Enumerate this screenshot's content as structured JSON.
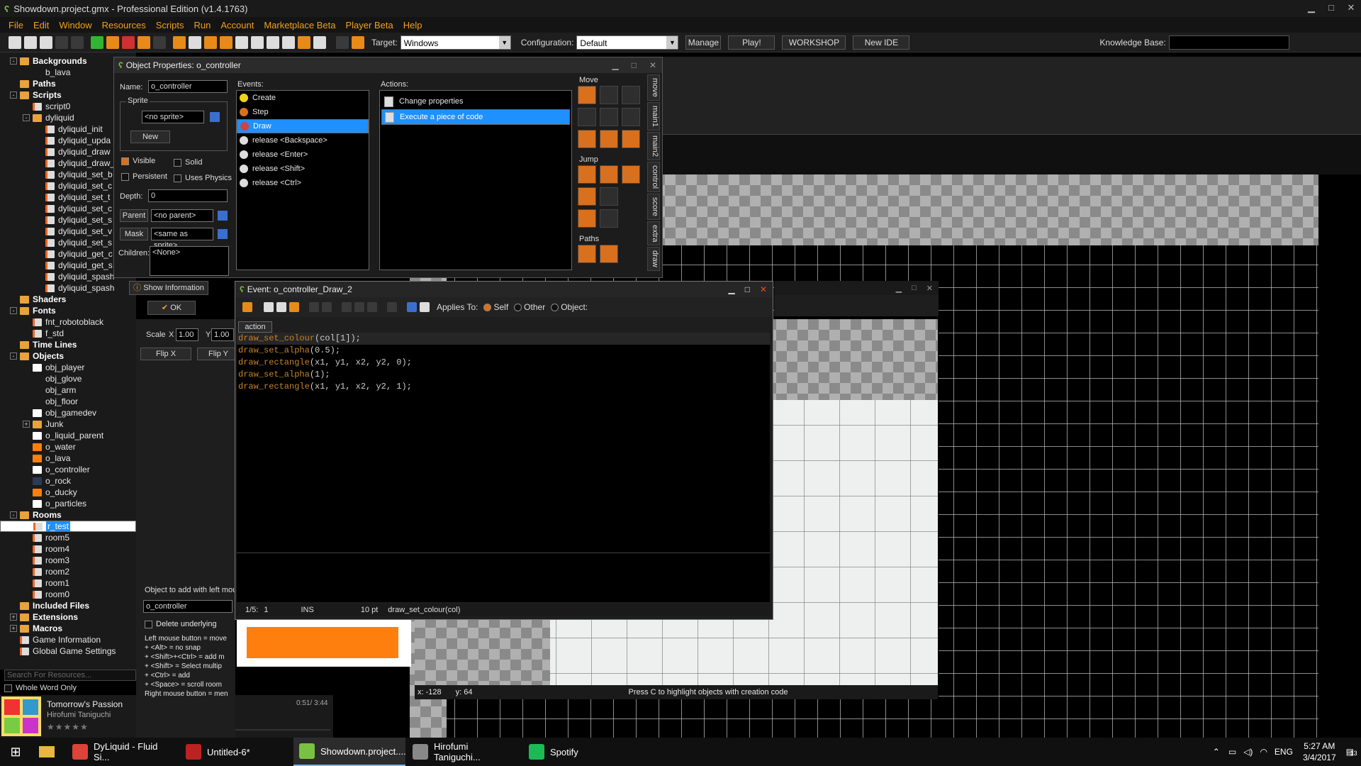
{
  "window": {
    "title": "Showdown.project.gmx - Professional Edition (v1.4.1763)"
  },
  "menu": [
    "File",
    "Edit",
    "Window",
    "Resources",
    "Scripts",
    "Run",
    "Account",
    "Marketplace Beta",
    "Player Beta",
    "Help"
  ],
  "toolbar": {
    "target_label": "Target:",
    "target_value": "Windows",
    "config_label": "Configuration:",
    "config_value": "Default",
    "manage": "Manage",
    "play": "Play!",
    "workshop": "WORKSHOP",
    "new_ide": "New IDE",
    "kb_label": "Knowledge Base:"
  },
  "tree": [
    {
      "label": "Backgrounds",
      "depth": 0,
      "type": "folder",
      "bold": true,
      "exp": "-"
    },
    {
      "label": "b_lava",
      "depth": 1,
      "type": "none"
    },
    {
      "label": "Paths",
      "depth": 0,
      "type": "folder",
      "bold": true
    },
    {
      "label": "Scripts",
      "depth": 0,
      "type": "folder",
      "bold": true,
      "exp": "-"
    },
    {
      "label": "script0",
      "depth": 1,
      "type": "file"
    },
    {
      "label": "dyliquid",
      "depth": 1,
      "type": "folder",
      "exp": "-"
    },
    {
      "label": "dyliquid_init",
      "depth": 2,
      "type": "file"
    },
    {
      "label": "dyliquid_upda",
      "depth": 2,
      "type": "file"
    },
    {
      "label": "dyliquid_draw",
      "depth": 2,
      "type": "file"
    },
    {
      "label": "dyliquid_draw_",
      "depth": 2,
      "type": "file"
    },
    {
      "label": "dyliquid_set_b",
      "depth": 2,
      "type": "file"
    },
    {
      "label": "dyliquid_set_c",
      "depth": 2,
      "type": "file"
    },
    {
      "label": "dyliquid_set_t",
      "depth": 2,
      "type": "file"
    },
    {
      "label": "dyliquid_set_c",
      "depth": 2,
      "type": "file"
    },
    {
      "label": "dyliquid_set_s",
      "depth": 2,
      "type": "file"
    },
    {
      "label": "dyliquid_set_v",
      "depth": 2,
      "type": "file"
    },
    {
      "label": "dyliquid_set_s",
      "depth": 2,
      "type": "file"
    },
    {
      "label": "dyliquid_get_c",
      "depth": 2,
      "type": "file"
    },
    {
      "label": "dyliquid_get_s",
      "depth": 2,
      "type": "file"
    },
    {
      "label": "dyliquid_spash",
      "depth": 2,
      "type": "file"
    },
    {
      "label": "dyliquid_spash",
      "depth": 2,
      "type": "file"
    },
    {
      "label": "Shaders",
      "depth": 0,
      "type": "folder",
      "bold": true
    },
    {
      "label": "Fonts",
      "depth": 0,
      "type": "folder",
      "bold": true,
      "exp": "-"
    },
    {
      "label": "fnt_robotoblack",
      "depth": 1,
      "type": "file"
    },
    {
      "label": "f_std",
      "depth": 1,
      "type": "file"
    },
    {
      "label": "Time Lines",
      "depth": 0,
      "type": "folder",
      "bold": true
    },
    {
      "label": "Objects",
      "depth": 0,
      "type": "folder",
      "bold": true,
      "exp": "-"
    },
    {
      "label": "obj_player",
      "depth": 1,
      "type": "swatch"
    },
    {
      "label": "obj_glove",
      "depth": 1,
      "type": "none"
    },
    {
      "label": "obj_arm",
      "depth": 1,
      "type": "none"
    },
    {
      "label": "obj_floor",
      "depth": 1,
      "type": "none"
    },
    {
      "label": "obj_gamedev",
      "depth": 1,
      "type": "swatch"
    },
    {
      "label": "Junk",
      "depth": 1,
      "type": "folder",
      "exp": "+"
    },
    {
      "label": "o_liquid_parent",
      "depth": 1,
      "type": "swatch"
    },
    {
      "label": "o_water",
      "depth": 1,
      "type": "orange"
    },
    {
      "label": "o_lava",
      "depth": 1,
      "type": "orange"
    },
    {
      "label": "o_controller",
      "depth": 1,
      "type": "swatch"
    },
    {
      "label": "o_rock",
      "depth": 1,
      "type": "rock"
    },
    {
      "label": "o_ducky",
      "depth": 1,
      "type": "orange"
    },
    {
      "label": "o_particles",
      "depth": 1,
      "type": "swatch"
    },
    {
      "label": "Rooms",
      "depth": 0,
      "type": "folder",
      "bold": true,
      "exp": "-"
    },
    {
      "label": "r_test",
      "depth": 1,
      "type": "file",
      "selected": true
    },
    {
      "label": "room5",
      "depth": 1,
      "type": "file"
    },
    {
      "label": "room4",
      "depth": 1,
      "type": "file"
    },
    {
      "label": "room3",
      "depth": 1,
      "type": "file"
    },
    {
      "label": "room2",
      "depth": 1,
      "type": "file"
    },
    {
      "label": "room1",
      "depth": 1,
      "type": "file"
    },
    {
      "label": "room0",
      "depth": 1,
      "type": "file"
    },
    {
      "label": "Included Files",
      "depth": 0,
      "type": "folder",
      "bold": true
    },
    {
      "label": "Extensions",
      "depth": 0,
      "type": "folder",
      "bold": true,
      "exp": "+"
    },
    {
      "label": "Macros",
      "depth": 0,
      "type": "folder",
      "bold": true,
      "exp": "+"
    },
    {
      "label": "Game Information",
      "depth": 0,
      "type": "file"
    },
    {
      "label": "Global Game Settings",
      "depth": 0,
      "type": "file"
    }
  ],
  "search": {
    "placeholder": "Search For Resources...",
    "whole_word": "Whole Word Only"
  },
  "player": {
    "track": "Tomorrow's Passion",
    "artist": "Hirofumi Taniguchi",
    "time": "0:51/ 3:44",
    "progress": 0.23
  },
  "objwin": {
    "title": "Object Properties: o_controller",
    "name_label": "Name:",
    "name": "o_controller",
    "sprite_label": "Sprite",
    "sprite": "<no sprite>",
    "new": "New",
    "visible": "Visible",
    "solid": "Solid",
    "persistent": "Persistent",
    "uses_physics": "Uses Physics",
    "depth_label": "Depth:",
    "depth": "0",
    "parent_label": "Parent",
    "parent": "<no parent>",
    "mask_label": "Mask",
    "mask": "<same as sprite>",
    "children_label": "Children:",
    "children": "<None>",
    "show_info": "Show Information",
    "ok": "OK",
    "events_label": "Events:",
    "actions_label": "Actions:",
    "move_label": "Move",
    "jump_label": "Jump",
    "paths_label": "Paths"
  },
  "events": [
    {
      "label": "Create",
      "color": "#f2d21c"
    },
    {
      "label": "Step",
      "color": "#d9701e"
    },
    {
      "label": "Draw",
      "color": "#cc4444",
      "selected": true
    },
    {
      "label": "release <Backspace>",
      "color": "#ddd"
    },
    {
      "label": "release <Enter>",
      "color": "#ddd"
    },
    {
      "label": "release <Shift>",
      "color": "#ddd"
    },
    {
      "label": "release <Ctrl>",
      "color": "#ddd"
    }
  ],
  "actions": [
    {
      "label": "Change properties"
    },
    {
      "label": "Execute a piece of code",
      "selected": true
    }
  ],
  "vtabs": [
    "move",
    "main1",
    "main2",
    "control",
    "score",
    "extra",
    "draw"
  ],
  "room": {
    "scale_label": "Scale",
    "x_label": "X",
    "scale_x": "1.00",
    "y_label": "Y",
    "scale_y": "1.00",
    "flipx": "Flip X",
    "flipy": "Flip Y",
    "obj_add_label": "Object to add with left mou",
    "obj_add": "o_controller",
    "delete_underlying": "Delete underlying",
    "help_lines": [
      "Left mouse button = move",
      "+ <Alt> = no snap",
      "+ <Shift>+<Ctrl> = add m",
      "+ <Shift> = Select multip",
      "+ <Ctrl> = add",
      "+ <Space> = scroll room",
      "Right mouse button = men"
    ],
    "coord_x": "x: -128",
    "coord_y": "y: 64",
    "hint": "Press C to highlight objects with creation code"
  },
  "codewin": {
    "title": "Event: o_controller_Draw_2",
    "applies_to": "Applies To:",
    "self": "Self",
    "other": "Other",
    "object": "Object:",
    "tab": "action",
    "status_pos": "1/5:",
    "status_col": "1",
    "status_mode": "INS",
    "status_size": "10 pt",
    "status_hint": "draw_set_colour(col)"
  },
  "code": [
    [
      {
        "t": "draw_set_colour",
        "c": "fn"
      },
      {
        "t": "(col[1]);",
        "c": "nm"
      }
    ],
    [
      {
        "t": "draw_set_alpha",
        "c": "fn"
      },
      {
        "t": "(0.5);",
        "c": "nm"
      }
    ],
    [
      {
        "t": "draw_rectangle",
        "c": "fn"
      },
      {
        "t": "(x1, y1, x2, y2, 0);",
        "c": "nm"
      }
    ],
    [
      {
        "t": "draw_set_alpha",
        "c": "fn"
      },
      {
        "t": "(1);",
        "c": "nm"
      }
    ],
    [
      {
        "t": "draw_rectangle",
        "c": "fn"
      },
      {
        "t": "(x1, y1, x2, y2, 1);",
        "c": "nm"
      }
    ]
  ],
  "taskbar": {
    "apps": [
      {
        "label": "DyLiquid - Fluid Si...",
        "icon": "chrome-icon",
        "color": "#db4437"
      },
      {
        "label": "Untitled-6*",
        "icon": "flash-icon",
        "color": "#b22"
      },
      {
        "label": "Showdown.project....",
        "icon": "gamemaker-icon",
        "color": "#7ac142",
        "active": true
      },
      {
        "label": "Hirofumi Taniguchi...",
        "icon": "music-player-icon",
        "color": "#888"
      },
      {
        "label": "Spotify",
        "icon": "spotify-icon",
        "color": "#1db954"
      }
    ],
    "lang": "ENG",
    "time": "5:27 AM",
    "date": "3/4/2017",
    "notif": "13"
  }
}
